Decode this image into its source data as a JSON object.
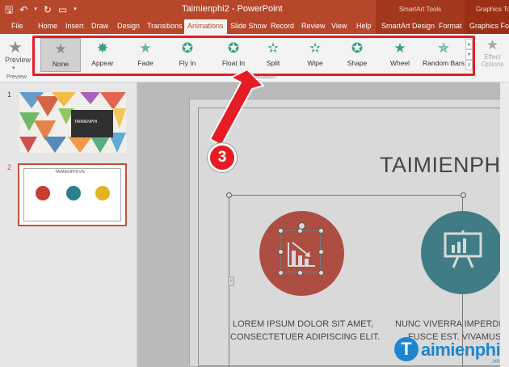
{
  "titlebar": {
    "doc_title": "Taimienphi2 - PowerPoint",
    "ctx_smartart": "SmartArt Tools",
    "ctx_graphics": "Graphics Too",
    "qat": [
      "save-icon",
      "undo-icon",
      "redo-icon",
      "refresh-icon",
      "present-icon",
      "dropdown-icon"
    ]
  },
  "tabs": [
    "File",
    "Home",
    "Insert",
    "Draw",
    "Design",
    "Transitions",
    "Animations",
    "Slide Show",
    "Record",
    "Review",
    "View",
    "Help",
    "SmartArt Design",
    "Format",
    "Graphics Form"
  ],
  "ribbon": {
    "preview_label": "Preview",
    "preview_group_label": "Preview",
    "animation_group_label": "Animation",
    "effect_label_1": "Effect",
    "effect_label_2": "Options",
    "animations": [
      {
        "label": "None",
        "icon": "none-star-icon"
      },
      {
        "label": "Appear",
        "icon": "appear-star-icon"
      },
      {
        "label": "Fade",
        "icon": "fade-star-icon"
      },
      {
        "label": "Fly In",
        "icon": "fly-in-star-icon"
      },
      {
        "label": "Float In",
        "icon": "float-in-star-icon"
      },
      {
        "label": "Split",
        "icon": "split-star-icon"
      },
      {
        "label": "Wipe",
        "icon": "wipe-star-icon"
      },
      {
        "label": "Shape",
        "icon": "shape-star-icon"
      },
      {
        "label": "Wheel",
        "icon": "wheel-star-icon"
      },
      {
        "label": "Random Bars",
        "icon": "random-bars-star-icon"
      }
    ],
    "selected_animation": "None"
  },
  "thumbnails": {
    "slide1_number": "1",
    "slide2_number": "2",
    "slide1_title": "TAIMIENPHI",
    "slide2_title": "TAIMIENPHI.VN"
  },
  "slide": {
    "title": "TAIMIENPHI.",
    "text_left_1": "LOREM IPSUM DOLOR SIT AMET,",
    "text_left_2": "CONSECTETUER ADIPISCING ELIT.",
    "text_right_1": "NUNC VIVERRA IMPERDIET",
    "text_right_2": "FUSCE EST. VIVAMUS A",
    "colors": {
      "red": "#c43f30",
      "teal": "#2a7f8c",
      "gold": "#e2b424"
    }
  },
  "callout": {
    "step": "3",
    "color": "#e61c24"
  },
  "watermark": {
    "initial": "T",
    "name": "aimienphi",
    "suffix": ".vn"
  }
}
